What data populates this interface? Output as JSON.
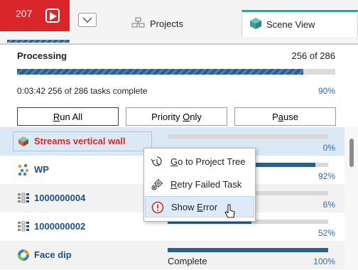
{
  "badge": {
    "count": "207"
  },
  "tabs": [
    {
      "label": "Projects"
    },
    {
      "label": "Scene View"
    }
  ],
  "processing": {
    "title": "Processing",
    "count": "256 of 286",
    "progress": 0.9,
    "status": "0:03:42 256 of 286 tasks complete",
    "percent": "90%",
    "buttons": {
      "run_all_mnemonic": "R",
      "run_all_rest": "un All",
      "priority_first": "Priority ",
      "priority_mnemonic": "O",
      "priority_rest": "nly",
      "pause_first": "P",
      "pause_mnemonic": "a",
      "pause_rest": "use"
    }
  },
  "tasks": [
    {
      "label": "Streams vertical wall",
      "icon": "surface-icon",
      "progress": 0.0,
      "percent": "0%",
      "error": true
    },
    {
      "label": "WP",
      "icon": "points-icon",
      "progress": 0.92,
      "percent": "92%"
    },
    {
      "label": "1000000004",
      "icon": "grid-icon",
      "progress": 0.06,
      "percent": "6%"
    },
    {
      "label": "1000000002",
      "icon": "grid-icon",
      "progress": 0.52,
      "percent": "52%"
    },
    {
      "label": "Face dip",
      "icon": "ring-icon",
      "progress": 1.0,
      "percent": "100%",
      "status": "Complete"
    }
  ],
  "context_menu": {
    "items": [
      {
        "label_mnemonic": "G",
        "label_rest": "o to Project Tree",
        "icon": "tree-icon"
      },
      {
        "label_mnemonic": "R",
        "label_rest": "etry Failed Task",
        "icon": "gears-icon"
      },
      {
        "label_first": "Show ",
        "label_mnemonic": "E",
        "label_rest": "rror",
        "icon": "error-icon"
      }
    ]
  },
  "colors": {
    "accent": "#d9262b",
    "bar": "#2a5f8e",
    "selection": "#dbe9f5",
    "link": "#1f4f85"
  }
}
